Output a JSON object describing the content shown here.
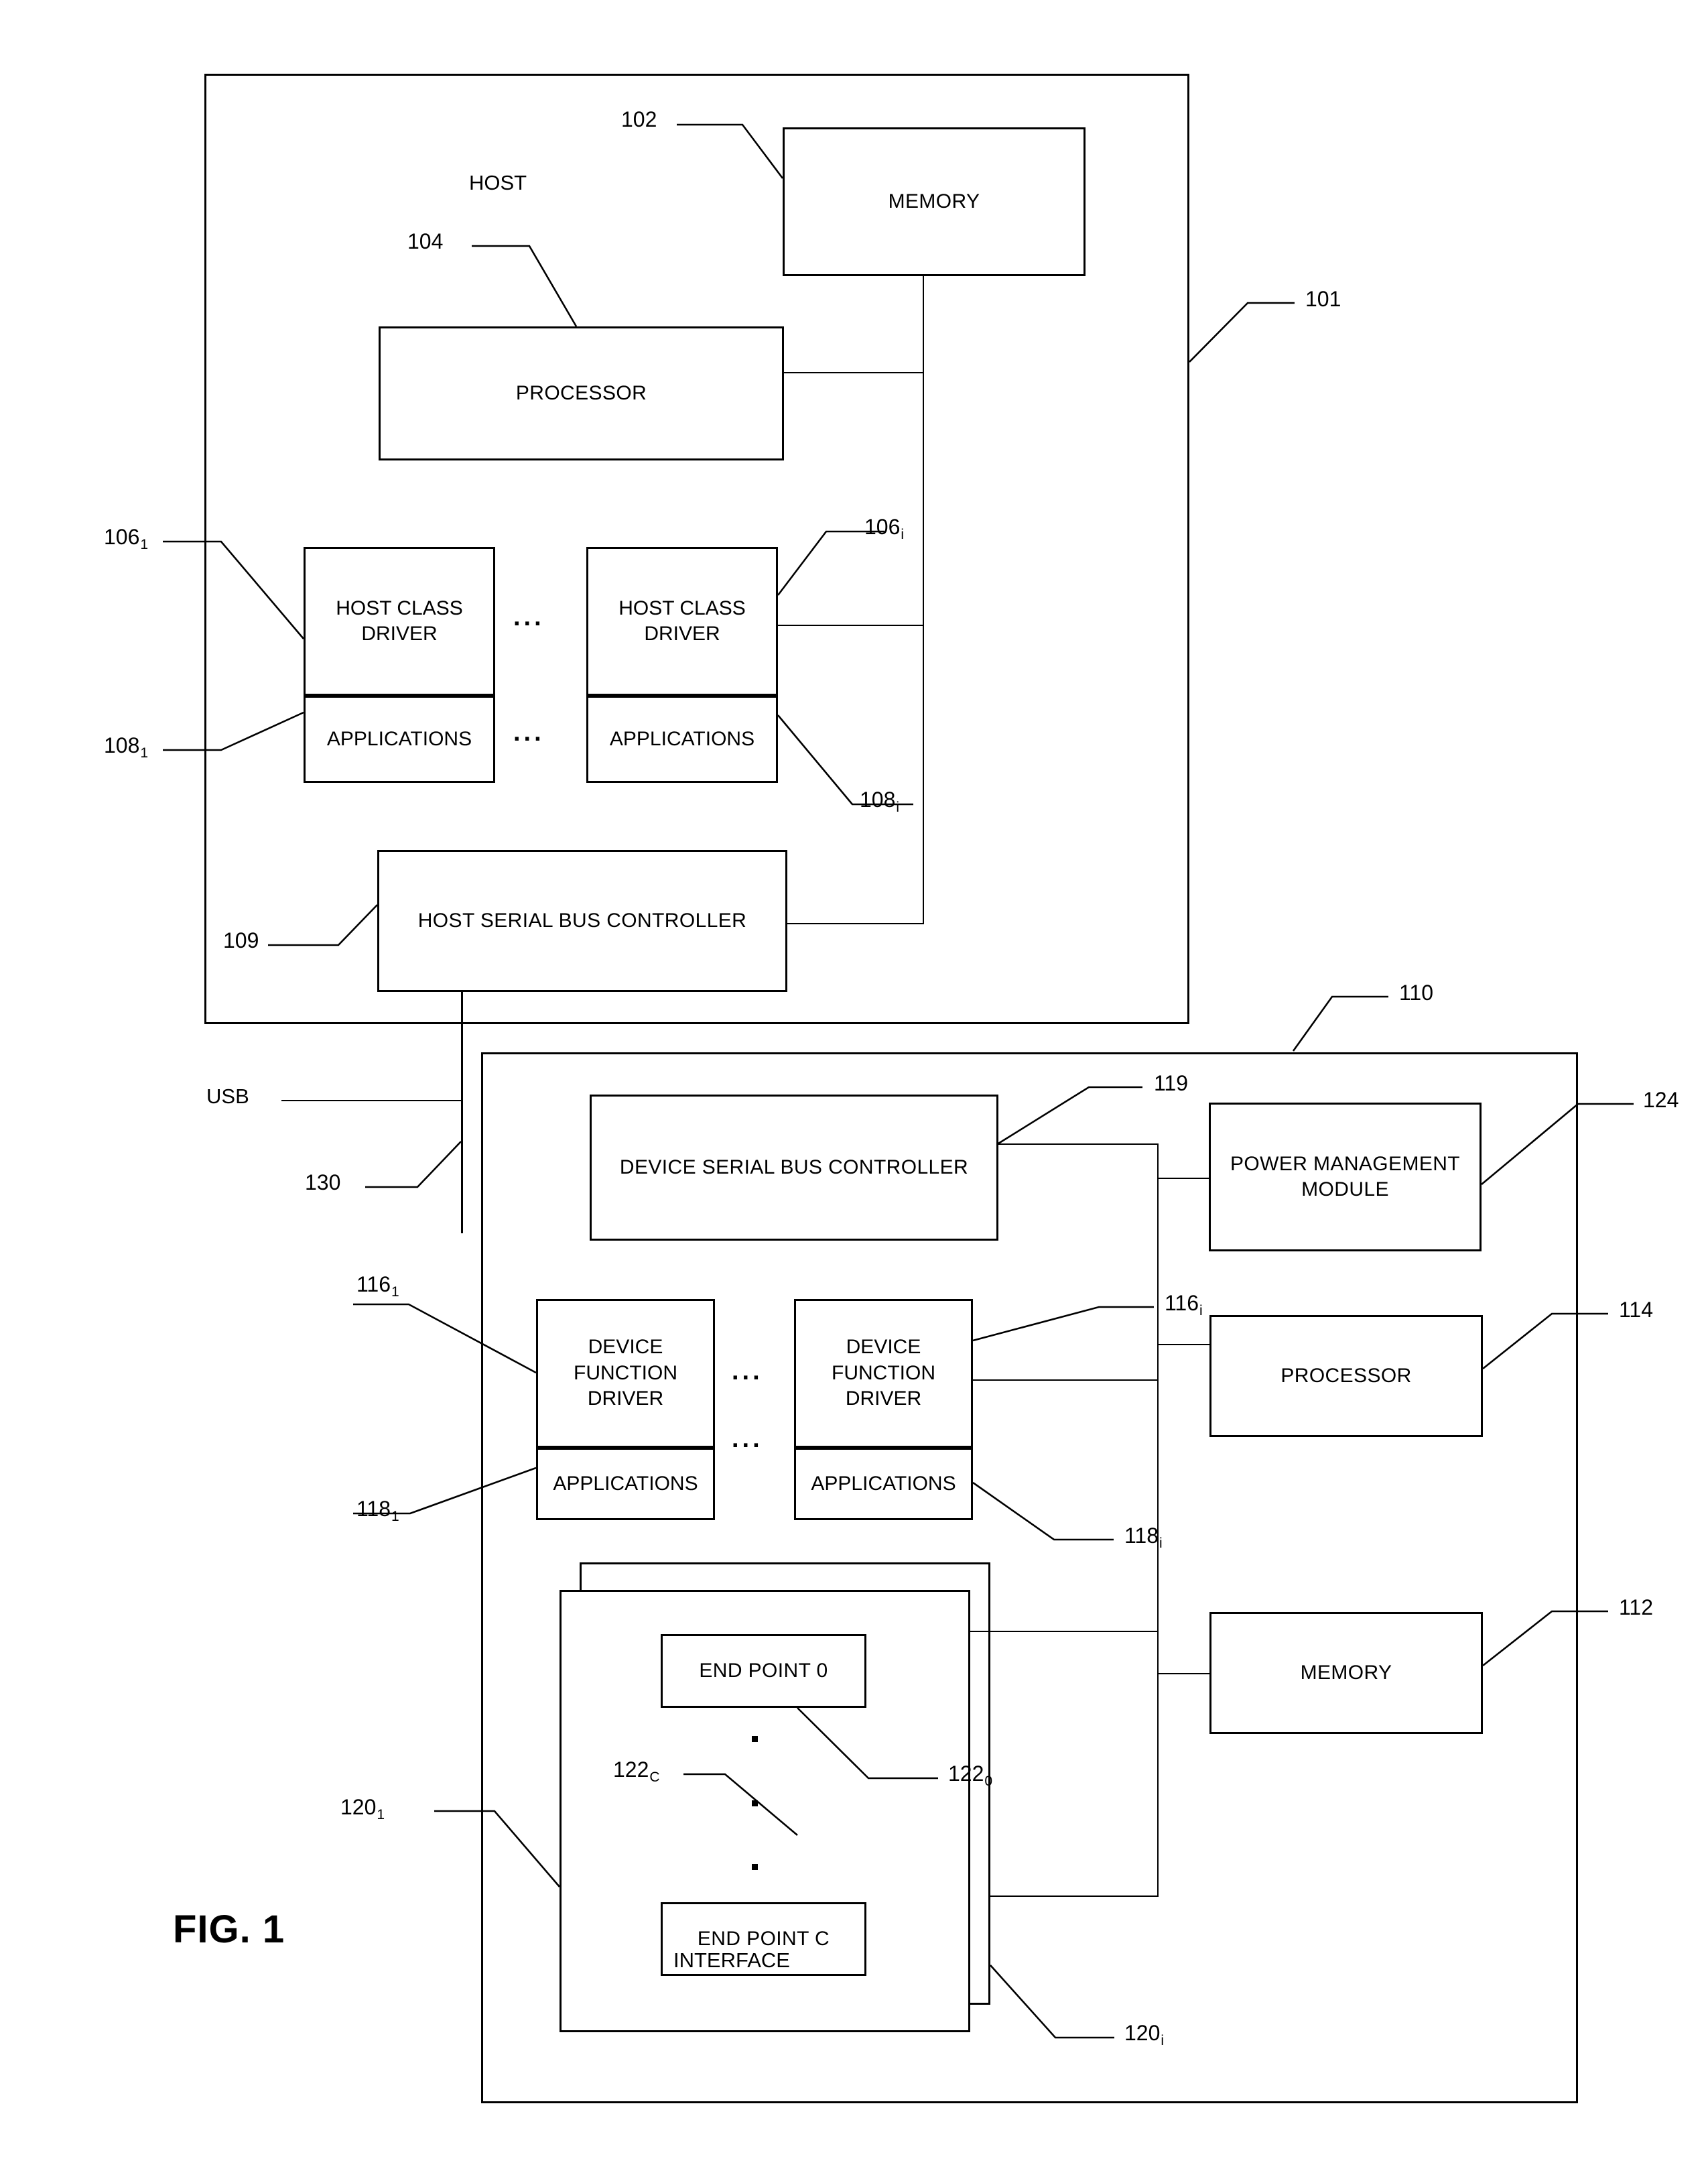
{
  "figure": {
    "caption": "FIG. 1"
  },
  "host": {
    "title": "HOST",
    "ref": "101",
    "memory": {
      "label": "MEMORY",
      "ref": "102"
    },
    "processor": {
      "label": "PROCESSOR",
      "ref": "104"
    },
    "class_drivers": [
      {
        "driver_label": "HOST CLASS DRIVER",
        "driver_ref": "106",
        "driver_sub": "1",
        "apps_label": "APPLICATIONS",
        "apps_ref": "108",
        "apps_sub": "1"
      },
      {
        "driver_label": "HOST CLASS DRIVER",
        "driver_ref": "106",
        "driver_sub": "i",
        "apps_label": "APPLICATIONS",
        "apps_ref": "108",
        "apps_sub": "i"
      }
    ],
    "serial_bus_controller": {
      "label": "HOST SERIAL BUS CONTROLLER",
      "ref": "109"
    },
    "ellipsis": "..."
  },
  "bus": {
    "label": "USB",
    "ref": "130"
  },
  "device": {
    "ref": "110",
    "serial_bus_controller": {
      "label": "DEVICE SERIAL BUS CONTROLLER",
      "ref": "119"
    },
    "power_management": {
      "label": "POWER MANAGEMENT MODULE",
      "ref": "124"
    },
    "processor": {
      "label": "PROCESSOR",
      "ref": "114"
    },
    "memory": {
      "label": "MEMORY",
      "ref": "112"
    },
    "function_drivers": [
      {
        "driver_label": "DEVICE FUNCTION DRIVER",
        "driver_ref": "116",
        "driver_sub": "1",
        "apps_label": "APPLICATIONS",
        "apps_ref": "118",
        "apps_sub": "1"
      },
      {
        "driver_label": "DEVICE FUNCTION DRIVER",
        "driver_ref": "116",
        "driver_sub": "i",
        "apps_label": "APPLICATIONS",
        "apps_ref": "118",
        "apps_sub": "i"
      }
    ],
    "interfaces": [
      {
        "label": "INTERFACE",
        "ref": "120",
        "sub": "1"
      },
      {
        "label": "INTERFACE",
        "ref": "120",
        "sub": "i"
      }
    ],
    "endpoints": [
      {
        "label": "END POINT 0",
        "ref": "122",
        "sub": "0"
      },
      {
        "label": "END POINT C",
        "ref": "122",
        "sub": "C"
      }
    ],
    "ellipsis": "..."
  }
}
